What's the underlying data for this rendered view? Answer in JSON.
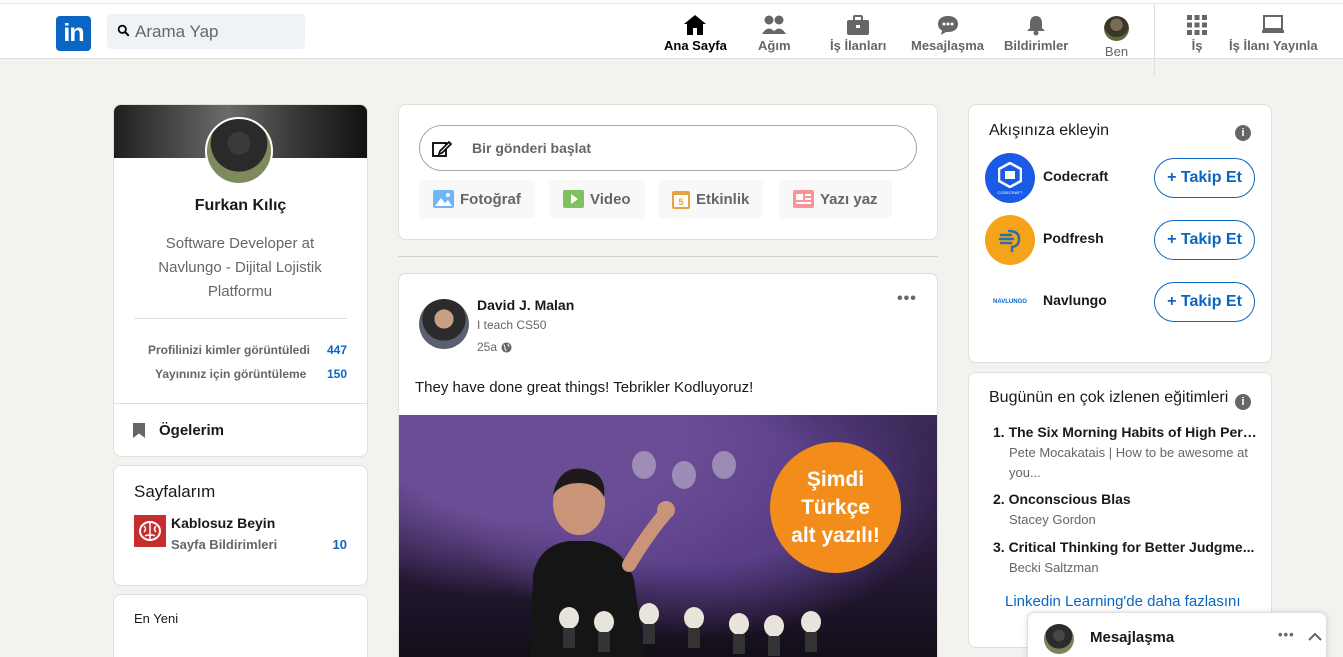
{
  "search": {
    "placeholder": "Arama Yap"
  },
  "nav": {
    "home": "Ana Sayfa",
    "network": "Ağım",
    "jobs": "İş İlanları",
    "messaging": "Mesajlaşma",
    "notifications": "Bildirimler",
    "me": "Ben",
    "work": "İş",
    "post_job": "İş İlanı Yayınla"
  },
  "profile": {
    "name": "Furkan Kılıç",
    "headline": "Software Developer at Navlungo - Dijital Lojistik Platformu",
    "stats": [
      {
        "label": "Profilinizi kimler görüntüledi",
        "value": "447"
      },
      {
        "label": "Yayınınız için görüntüleme",
        "value": "150"
      }
    ],
    "my_items": "Ögelerim"
  },
  "pages": {
    "title": "Sayfalarım",
    "page_name": "Kablosuz Beyin",
    "page_sub": "Sayfa Bildirimleri",
    "page_count": "10"
  },
  "recent": {
    "label": "En Yeni"
  },
  "composer": {
    "placeholder": "Bir gönderi başlat",
    "photo": "Fotoğraf",
    "video": "Video",
    "event": "Etkinlik",
    "article": "Yazı yaz"
  },
  "post": {
    "author": "David J. Malan",
    "headline": "I teach CS50",
    "time": "25a",
    "text": "They have done great things! Tebrikler Kodluyoruz!",
    "badge": [
      "Şimdi",
      "Türkçe",
      "alt yazılı!"
    ]
  },
  "follow": {
    "title": "Akışınıza ekleyin",
    "button": "+ Takip Et",
    "items": [
      {
        "name": "Codecraft",
        "logo_text": "CODECRAFT"
      },
      {
        "name": "Podfresh"
      },
      {
        "name": "Navlungo",
        "logo_text": "NAVLUNGO"
      }
    ]
  },
  "learning": {
    "title": "Bugünün en çok izlenen eğitimleri",
    "courses": [
      {
        "title": "1. The Six Morning Habits of High Perf...",
        "author": "Pete Mocakatais | How to be awesome at you..."
      },
      {
        "title": "2. Onconscious Blas",
        "author": "Stacey Gordon"
      },
      {
        "title": "3. Critical Thinking for Better Judgme...",
        "author": "Becki Saltzman"
      }
    ],
    "more": "Linkedin Learning'de daha fazlasını"
  },
  "messaging_bar": {
    "title": "Mesajlaşma"
  },
  "colors": {
    "brand": "#0a66c2",
    "badge": "#f28c1a",
    "page_logo": "#c62e2e"
  }
}
